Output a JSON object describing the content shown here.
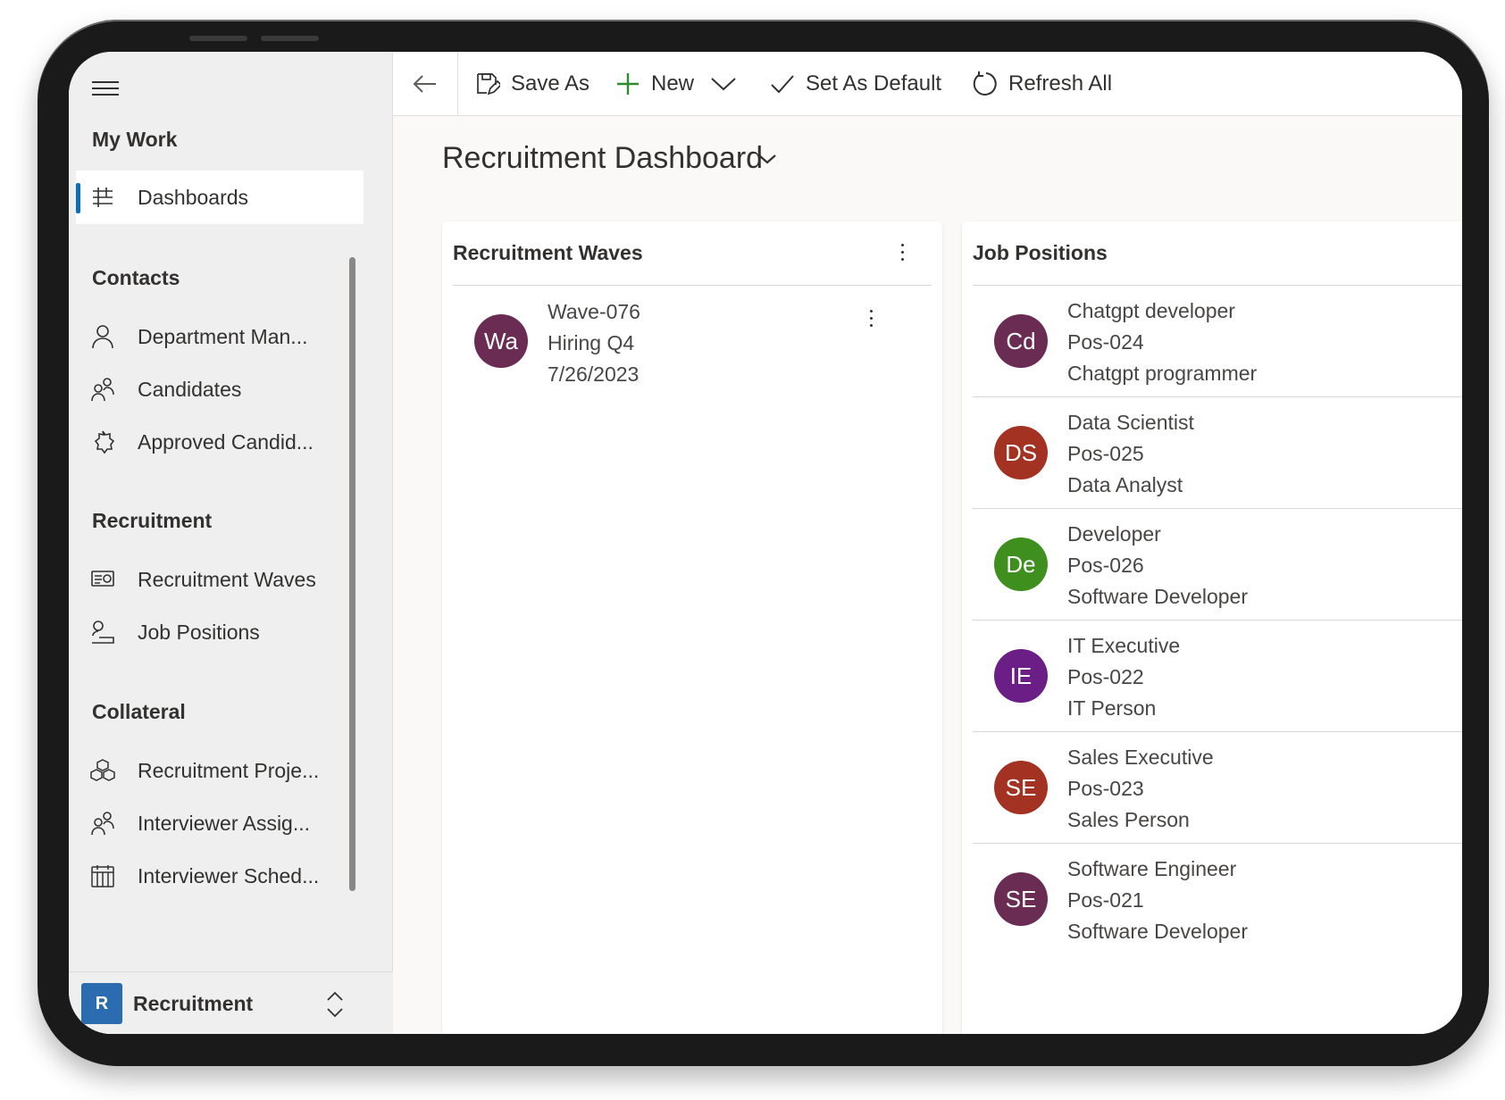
{
  "toolbar": {
    "back_icon": "arrow-left-icon",
    "save_as_label": "Save As",
    "new_label": "New",
    "set_default_label": "Set As Default",
    "refresh_label": "Refresh All"
  },
  "sidebar": {
    "groups": [
      {
        "title": "My Work",
        "items": [
          {
            "label": "Dashboards",
            "icon": "dashboard-icon",
            "active": true
          }
        ]
      },
      {
        "title": "Contacts",
        "items": [
          {
            "label": "Department Man...",
            "icon": "person-icon"
          },
          {
            "label": "Candidates",
            "icon": "people-icon"
          },
          {
            "label": "Approved Candid...",
            "icon": "badge-icon"
          }
        ]
      },
      {
        "title": "Recruitment",
        "items": [
          {
            "label": "Recruitment Waves",
            "icon": "waves-icon"
          },
          {
            "label": "Job Positions",
            "icon": "position-icon"
          }
        ]
      },
      {
        "title": "Collateral",
        "items": [
          {
            "label": "Recruitment Proje...",
            "icon": "cubes-icon"
          },
          {
            "label": "Interviewer Assig...",
            "icon": "people-icon"
          },
          {
            "label": "Interviewer Sched...",
            "icon": "calendar-icon"
          }
        ]
      }
    ],
    "area": {
      "badge": "R",
      "label": "Recruitment"
    }
  },
  "main": {
    "title": "Recruitment Dashboard",
    "waves_card": {
      "title": "Recruitment Waves",
      "records": [
        {
          "initials": "Wa",
          "color": "#6b2c54",
          "lines": [
            "Wave-076",
            "Hiring Q4",
            "7/26/2023"
          ]
        }
      ]
    },
    "jobs_card": {
      "title": "Job Positions",
      "records": [
        {
          "initials": "Cd",
          "color": "#6b2c54",
          "lines": [
            "Chatgpt developer",
            "Pos-024",
            "Chatgpt programmer"
          ]
        },
        {
          "initials": "DS",
          "color": "#a33222",
          "lines": [
            "Data Scientist",
            "Pos-025",
            "Data Analyst"
          ]
        },
        {
          "initials": "De",
          "color": "#3f8f1f",
          "lines": [
            "Developer",
            "Pos-026",
            "Software Developer"
          ]
        },
        {
          "initials": "IE",
          "color": "#6b1f86",
          "lines": [
            "IT Executive",
            "Pos-022",
            "IT Person"
          ]
        },
        {
          "initials": "SE",
          "color": "#a33222",
          "lines": [
            "Sales Executive",
            "Pos-023",
            "Sales Person"
          ]
        },
        {
          "initials": "SE",
          "color": "#6b2c54",
          "lines": [
            "Software Engineer",
            "Pos-021",
            "Software Developer"
          ]
        }
      ]
    }
  }
}
